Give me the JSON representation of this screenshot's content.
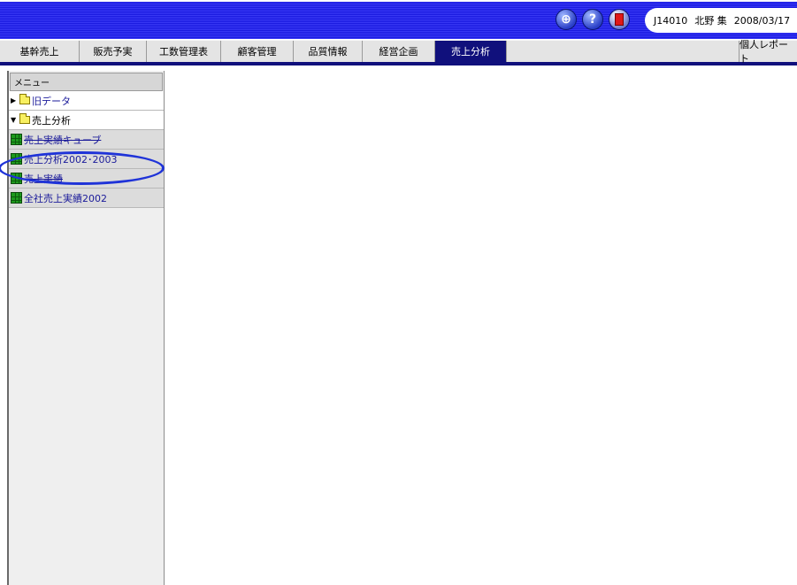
{
  "header": {
    "icons": [
      "network-icon",
      "help-icon",
      "exit-icon"
    ],
    "user_code": "J14010",
    "user_name": "北野 集",
    "date": "2008/03/17"
  },
  "tabs": [
    {
      "label": "基幹売上",
      "active": false
    },
    {
      "label": "販売予実",
      "active": false
    },
    {
      "label": "工数管理表",
      "active": false
    },
    {
      "label": "顧客管理",
      "active": false
    },
    {
      "label": "品質情報",
      "active": false
    },
    {
      "label": "経営企画",
      "active": false
    },
    {
      "label": "売上分析",
      "active": true
    }
  ],
  "personal_report_label": "個人レポート",
  "sidebar": {
    "header": "メニュー",
    "items": [
      {
        "label": "旧データ",
        "type": "folder",
        "expanded": false
      },
      {
        "label": "売上分析",
        "type": "folder",
        "expanded": true
      },
      {
        "label": "売上実績キューブ",
        "type": "cube"
      },
      {
        "label": "売上分析2002･2003",
        "type": "cube"
      },
      {
        "label": "売上実績",
        "type": "cube"
      },
      {
        "label": "全社売上実績2002",
        "type": "cube"
      }
    ]
  },
  "colors": {
    "banner": "#2a2aee",
    "active_tab": "#10107c",
    "highlight": "#1f33d8",
    "link_text": "#1a1a9a"
  }
}
